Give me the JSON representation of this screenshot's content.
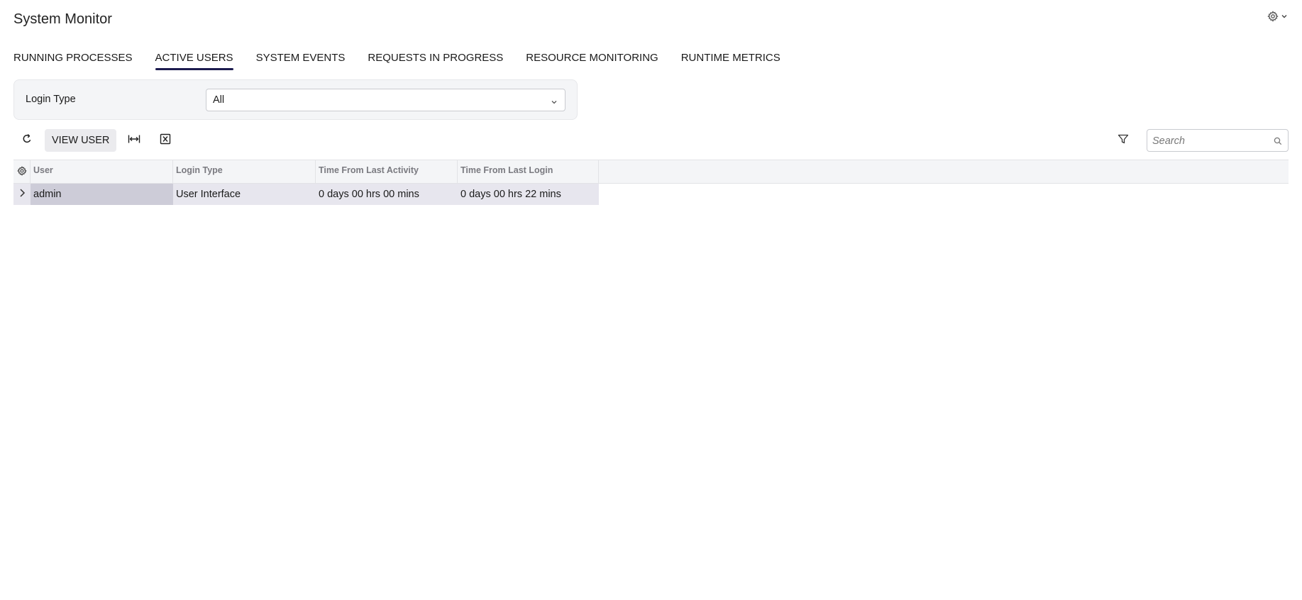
{
  "header": {
    "title": "System Monitor",
    "settings_icon": "gear-icon",
    "settings_caret": "chevron-down-icon"
  },
  "tabs": [
    {
      "label": "RUNNING PROCESSES",
      "active": false
    },
    {
      "label": "ACTIVE USERS",
      "active": true
    },
    {
      "label": "SYSTEM EVENTS",
      "active": false
    },
    {
      "label": "REQUESTS IN PROGRESS",
      "active": false
    },
    {
      "label": "RESOURCE MONITORING",
      "active": false
    },
    {
      "label": "RUNTIME METRICS",
      "active": false
    }
  ],
  "filter": {
    "login_type_label": "Login Type",
    "login_type_value": "All"
  },
  "toolbar": {
    "refresh_icon": "refresh-icon",
    "view_user_label": "VIEW USER",
    "fit_columns_icon": "fit-columns-icon",
    "export_excel_icon": "export-excel-icon",
    "filter_icon": "filter-icon",
    "search_placeholder": "Search",
    "search_icon": "search-icon"
  },
  "grid": {
    "columns": [
      "User",
      "Login Type",
      "Time From Last Activity",
      "Time From Last Login"
    ],
    "rows": [
      {
        "user": "admin",
        "login_type": "User Interface",
        "last_activity": "0 days 00 hrs 00 mins",
        "last_login": "0 days 00 hrs 22 mins"
      }
    ]
  },
  "colors": {
    "accent": "#1c1b4f",
    "row_selected": "#e7e6ee",
    "cell_selected": "#cdccd8",
    "header_bg": "#f4f5f7"
  }
}
